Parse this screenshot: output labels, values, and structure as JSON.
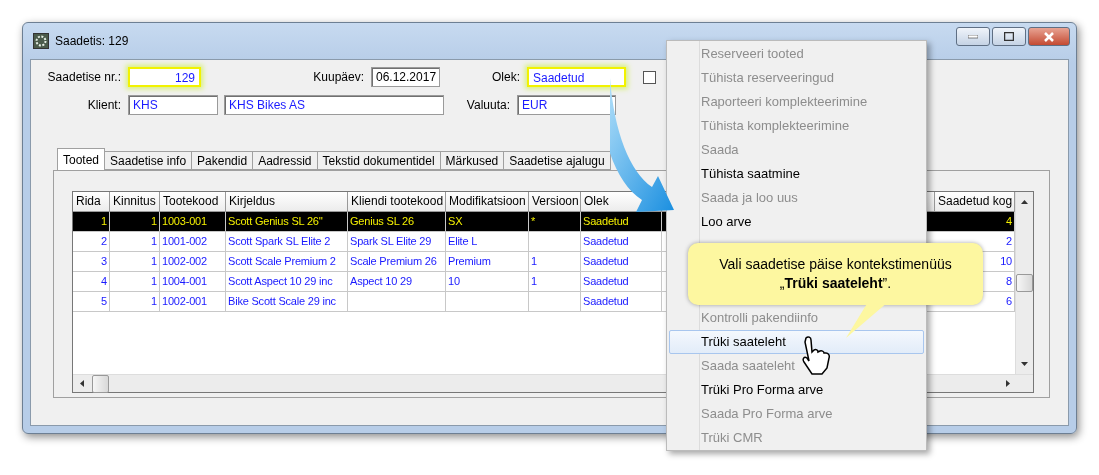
{
  "window": {
    "title": "Saadetis: 129"
  },
  "form": {
    "rows": [
      {
        "fields": [
          {
            "label": "Saadetise nr.:",
            "value": "129",
            "highlighted": true,
            "kind": "number"
          },
          {
            "label": "Kuupäev:",
            "value": "06.12.2017",
            "highlighted": false,
            "kind": "date"
          },
          {
            "label": "Olek:",
            "value": "Saadetud",
            "highlighted": true,
            "kind": "field"
          }
        ],
        "checkbox": {
          "checked": false
        }
      },
      {
        "fields": [
          {
            "label": "Klient:",
            "value": "KHS",
            "highlighted": false,
            "kind": "field"
          },
          {
            "value": "KHS Bikes AS",
            "highlighted": false,
            "kind": "wide"
          },
          {
            "label": "Valuuta:",
            "value": "EUR",
            "highlighted": false,
            "kind": "field"
          }
        ]
      }
    ]
  },
  "tabs": [
    {
      "label": "Tooted",
      "selected": true
    },
    {
      "label": "Saadetise info",
      "selected": false
    },
    {
      "label": "Pakendid",
      "selected": false
    },
    {
      "label": "Aadressid",
      "selected": false
    },
    {
      "label": "Tekstid dokumentidel",
      "selected": false
    },
    {
      "label": "Märkused",
      "selected": false
    },
    {
      "label": "Saadetise ajalugu",
      "selected": false
    }
  ],
  "table": {
    "columns": [
      "Rida",
      "Kinnitus",
      "Tootekood",
      "Kirjeldus",
      "Kliendi tootekood",
      "Modifikatsioon",
      "Versioon",
      "Olek",
      "Saadetud kog"
    ],
    "rows": [
      {
        "selected": true,
        "cells": [
          "1",
          "1",
          "1003-001",
          "Scott Genius SL 26''",
          "Genius SL 26",
          "SX",
          "*",
          "Saadetud",
          "4"
        ]
      },
      {
        "selected": false,
        "cells": [
          "2",
          "1",
          "1001-002",
          "Scott Spark SL Elite 2",
          "Spark SL Elite 29",
          "Elite L",
          "",
          "Saadetud",
          "2"
        ]
      },
      {
        "selected": false,
        "cells": [
          "3",
          "1",
          "1002-002",
          "Scott Scale Premium 2",
          "Scale Premium 26",
          "Premium",
          "1",
          "Saadetud",
          "10"
        ]
      },
      {
        "selected": false,
        "cells": [
          "4",
          "1",
          "1004-001",
          "Scott Aspect 10 29 inc",
          "Aspect 10 29",
          "10",
          "1",
          "Saadetud",
          "8"
        ]
      },
      {
        "selected": false,
        "cells": [
          "5",
          "1",
          "1002-001",
          "Bike Scott Scale 29 inc",
          "",
          "",
          "",
          "Saadetud",
          "6"
        ]
      }
    ]
  },
  "context_menu": {
    "items": [
      {
        "kind": "item",
        "label": "Reserveeri tooted",
        "disabled": true,
        "selected": false
      },
      {
        "kind": "item",
        "label": "Tühista reserveeringud",
        "disabled": true,
        "selected": false
      },
      {
        "kind": "item",
        "label": "Raporteeri komplekteerimine",
        "disabled": true,
        "selected": false
      },
      {
        "kind": "item",
        "label": "Tühista komplekteerimine",
        "disabled": true,
        "selected": false
      },
      {
        "kind": "item",
        "label": "Saada",
        "disabled": true,
        "selected": false
      },
      {
        "kind": "item",
        "label": "Tühista saatmine",
        "disabled": false,
        "selected": false
      },
      {
        "kind": "item",
        "label": "Saada ja loo uus",
        "disabled": true,
        "selected": false
      },
      {
        "kind": "item",
        "label": "Loo arve",
        "disabled": false,
        "selected": false
      },
      {
        "kind": "covered"
      },
      {
        "kind": "covered"
      },
      {
        "kind": "covered"
      },
      {
        "kind": "item",
        "label": "Kontrolli pakendiinfo",
        "disabled": true,
        "selected": false
      },
      {
        "kind": "item",
        "label": "Trüki saateleht",
        "disabled": false,
        "selected": true
      },
      {
        "kind": "item",
        "label": "Saada saateleht",
        "disabled": true,
        "selected": false
      },
      {
        "kind": "item",
        "label": "Trüki Pro Forma arve",
        "disabled": false,
        "selected": false
      },
      {
        "kind": "item",
        "label": "Saada Pro Forma arve",
        "disabled": true,
        "selected": false
      },
      {
        "kind": "item",
        "label": "Trüki CMR",
        "disabled": true,
        "selected": false
      }
    ]
  },
  "callout": {
    "lines": [
      "Vali saadetise päise kontekstimenüüs",
      "„**Trüki saateleht**”."
    ]
  }
}
